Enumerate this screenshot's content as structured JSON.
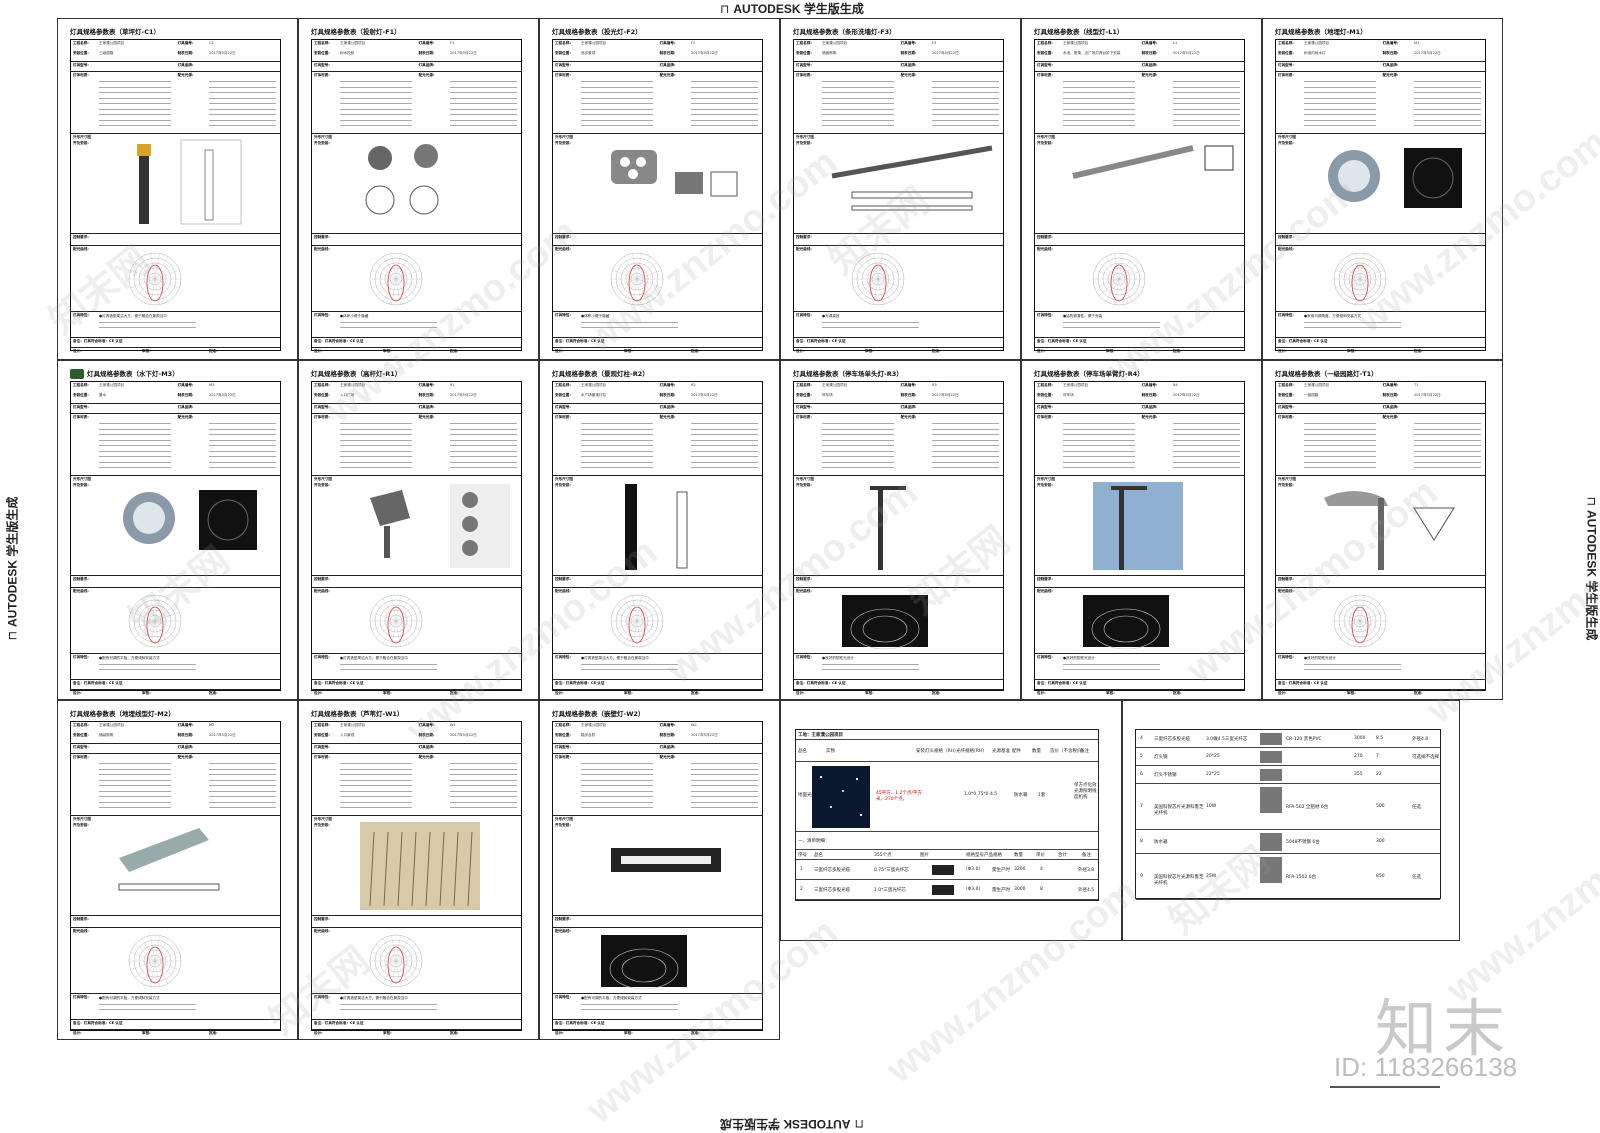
{
  "stamps": {
    "top": "AUTODESK 学生版生成",
    "bottom": "AUTODESK 学生版生成",
    "left": "AUTODESK 学生版生成",
    "right": "AUTODESK 学生版生成",
    "mark": "⊓"
  },
  "form_labels": {
    "project": "工程名称:",
    "location": "安装位置:",
    "fixture_no": "灯具编号:",
    "date": "制表日期:",
    "brand": "灯具品牌:",
    "model": "灯具型号:",
    "material": "灯体材质:",
    "light_source": "配光光源:",
    "size": "外形尺寸图",
    "install": "开及安装:",
    "control": "控制要求:",
    "curve": "配光曲线:",
    "feature": "灯具特性:",
    "note": "备注：灯具符合标准：CE 认证",
    "designer": "设计:",
    "reviewer": "审核:",
    "approver": "批准:"
  },
  "common": {
    "project_value": "王家濮公园项目",
    "date_value": "2017年5月22日"
  },
  "sheets": [
    {
      "title": "灯具规格参数表（草坪灯-C1）",
      "code": "C1",
      "location": "三级园路",
      "feature": "●灯具造型简洁大方，便于融合在景观当中"
    },
    {
      "title": "灯具规格参数表（投射灯-F1）",
      "code": "F1",
      "location": "树木投射",
      "feature": "●体积小便于隐藏"
    },
    {
      "title": "灯具规格参数表（投光灯-F2）",
      "code": "F2",
      "location": "追步景观",
      "feature": "●体积小便于隐藏"
    },
    {
      "title": "灯具规格参数表（条形洗墙灯-F3）",
      "code": "F3",
      "location": "墙面照明",
      "feature": "●光源高效"
    },
    {
      "title": "灯具规格参数表（线型灯-L1）",
      "code": "L1",
      "location": "水池、座椅、边广场灯具台阶下安装",
      "feature": "●结构紧凑性，便于安装"
    },
    {
      "title": "灯具规格参数表（地埋灯-M1）",
      "code": "M1",
      "location": "树池内树木灯",
      "feature": "●采用可调角度，方便倾斜安装方式"
    },
    {
      "title": "灯具规格参数表（水下灯-M3）",
      "code": "M3",
      "location": "景水",
      "feature": "●配有可调的平板，方便倾斜安装方式"
    },
    {
      "title": "灯具规格参数表（高杆灯-R1）",
      "code": "R1",
      "location": "入口广场",
      "feature": "●灯具造型简洁大方，便于融合在景观当中"
    },
    {
      "title": "灯具规格参数表（景观灯柱-R2）",
      "code": "R2",
      "location": "水广场景观灯柱",
      "feature": "●灯具造型简洁大方，便于融合在景观当中"
    },
    {
      "title": "灯具规格参数表（停车场单头灯-R3）",
      "code": "R3",
      "location": "停车场",
      "feature": "●良好的防眩光设计"
    },
    {
      "title": "灯具规格参数表（停车场单臂灯-R4）",
      "code": "R4",
      "location": "停车场",
      "feature": "●良好的防眩光设计"
    },
    {
      "title": "灯具规格参数表（一级园路灯-T1）",
      "code": "T1",
      "location": "一级园路",
      "feature": "●良好的防眩光设计"
    },
    {
      "title": "灯具规格参数表（地埋线型灯-M2）",
      "code": "M2",
      "location": "铺装照明",
      "feature": "●配有可调的平板，方便倾斜安装方式"
    },
    {
      "title": "灯具规格参数表（芦苇灯-W1）",
      "code": "W1",
      "location": "入口景观",
      "feature": "●灯具造型简洁大方，便于融合在景观当中"
    },
    {
      "title": "灯具规格参数表（嵌壁灯-W2）",
      "code": "W2",
      "location": "踏步台阶",
      "feature": "●配有可调的平板，方便倾斜安装方式"
    }
  ],
  "table_a": {
    "header": "工地：王家濮公园项目",
    "cols": [
      "品名",
      "实物",
      "安装灯头规格（RH）",
      "光纤规格(RH)",
      "光源基准",
      "配件",
      "数量",
      "造价（不含税价）",
      "备注"
    ],
    "product": "地面光纤灯",
    "product_note": "45平方，1.2个点/平方米，270个点。",
    "spec": "1.0*0.75*0.4.5",
    "material": "防水箱",
    "qty": "1套",
    "remark": "单方点化效光源照明线度机构",
    "sub_header": "一、清单明细：",
    "sub_cols": [
      "序号",
      "品名",
      "355个点",
      "图片",
      "规格型号产品规格",
      "数量",
      "单价",
      "合计",
      "备注"
    ],
    "rows": [
      {
        "no": "1",
        "name": "三蛋纤芯多股光缆",
        "spec": "0.75*三蛋光纤芯",
        "model": "(Φ3.0)",
        "note": "需生产时",
        "qty": "3200",
        "unit": "4",
        "remark": "外径3.8"
      },
      {
        "no": "2",
        "name": "三蛋纤芯多股光缆",
        "spec": "1.0*三蛋光纤芯",
        "model": "(Φ3.0)",
        "note": "需生产时",
        "qty": "3000",
        "unit": "8",
        "remark": "外径4.5"
      }
    ]
  },
  "table_b": {
    "rows": [
      {
        "no": "4",
        "name": "三蛋纤芯多股光缆",
        "spec": "3.0做4.5三蛋光纤芯",
        "model": "CR-120 黑色PVC",
        "qty": "3000",
        "unit": "8.5",
        "remark": "外径4.8"
      },
      {
        "no": "5",
        "name": "灯头钢",
        "spec": "20*25",
        "model": "",
        "qty": "270",
        "unit": "7",
        "remark": "可选择不选择"
      },
      {
        "no": "6",
        "name": "灯头不锈钢",
        "spec": "22*25",
        "model": "",
        "qty": "355",
        "unit": "22",
        "remark": ""
      },
      {
        "no": "7",
        "name": "美国科锐芯片光源科鲁芝光纤机",
        "spec": "10W",
        "model": "RFA-502 全铝材 6台",
        "qty": "",
        "unit": "500",
        "remark": "任选"
      },
      {
        "no": "8",
        "name": "防水箱",
        "spec": "",
        "model": "5048不锈钢 6台",
        "qty": "",
        "unit": "300",
        "remark": ""
      },
      {
        "no": "9",
        "name": "美国科锐芯片光源科鲁芝光纤机",
        "spec": "25W",
        "model": "RFA-1502 6台",
        "qty": "",
        "unit": "850",
        "remark": "任选"
      }
    ]
  },
  "watermark": "www.znzmo.com",
  "watermark_cn": "知末网",
  "logo": "知末",
  "id_text": "ID: 1183266138"
}
